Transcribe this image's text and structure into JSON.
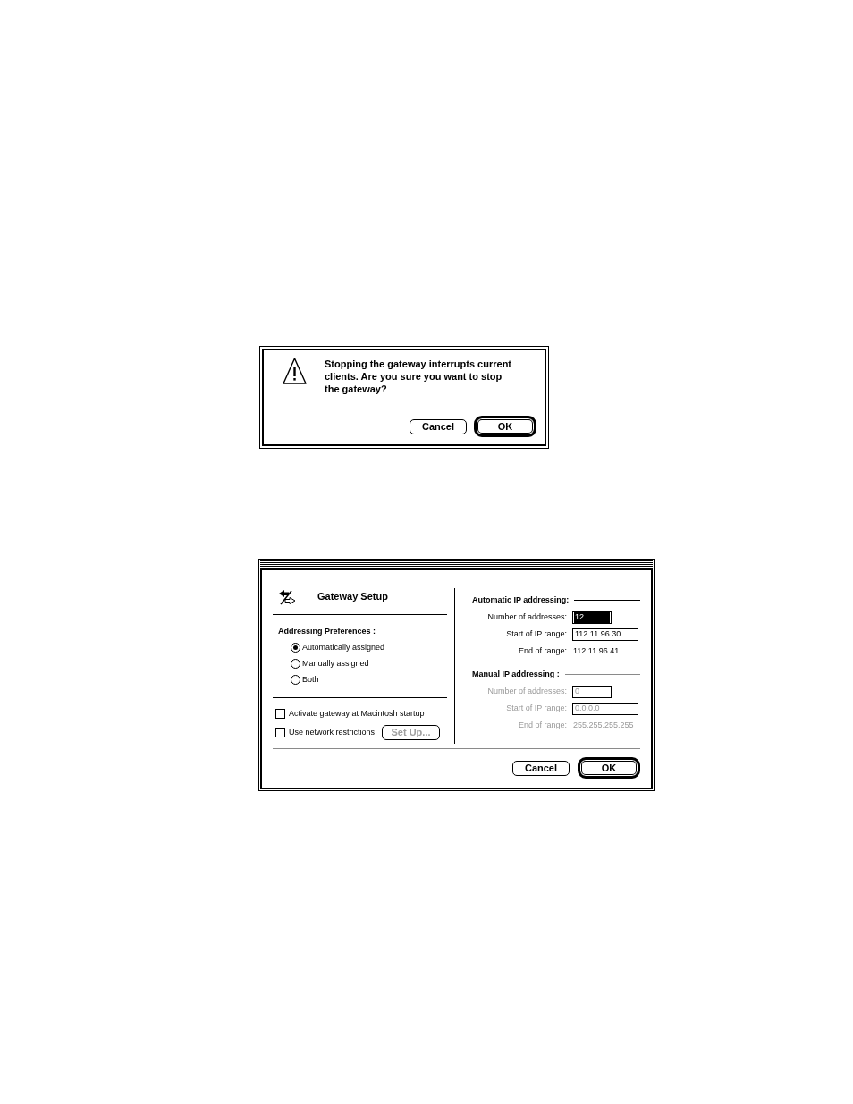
{
  "alert": {
    "kind": "caution",
    "message": "Stopping the gateway interrupts current clients. Are you sure you want to stop the gateway?",
    "buttons": [
      {
        "label": "Cancel",
        "default": false
      },
      {
        "label": "OK",
        "default": true
      }
    ]
  },
  "gateway_setup": {
    "title": "Gateway Setup",
    "addressing_preferences": {
      "heading": "Addressing Preferences :",
      "options": [
        {
          "label": "Automatically assigned",
          "selected": true
        },
        {
          "label": "Manually assigned",
          "selected": false
        },
        {
          "label": "Both",
          "selected": false
        }
      ]
    },
    "options": [
      {
        "label": "Activate gateway at Macintosh startup",
        "checked": false
      },
      {
        "label": "Use network restrictions",
        "checked": false,
        "button": {
          "label": "Set Up...",
          "disabled": true
        }
      }
    ],
    "automatic_ip": {
      "heading": "Automatic IP addressing:",
      "fields": [
        {
          "kind": "input",
          "label": "Number of addresses:",
          "value": "12",
          "selected": true,
          "disabled": false
        },
        {
          "kind": "input",
          "label": "Start of IP range:",
          "value": "112.11.96.30",
          "selected": false,
          "disabled": false
        },
        {
          "kind": "text",
          "label": "End of range:",
          "value": "112.11.96.41",
          "disabled": false
        }
      ]
    },
    "manual_ip": {
      "heading": "Manual IP addressing :",
      "fields": [
        {
          "kind": "input",
          "label": "Number of addresses:",
          "value": "0",
          "selected": false,
          "disabled": true
        },
        {
          "kind": "input",
          "label": "Start of IP range:",
          "value": "0.0.0.0",
          "selected": false,
          "disabled": true
        },
        {
          "kind": "text",
          "label": "End of range:",
          "value": "255.255.255.255",
          "disabled": true
        }
      ]
    },
    "buttons": [
      {
        "label": "Cancel",
        "default": false
      },
      {
        "label": "OK",
        "default": true
      }
    ]
  }
}
